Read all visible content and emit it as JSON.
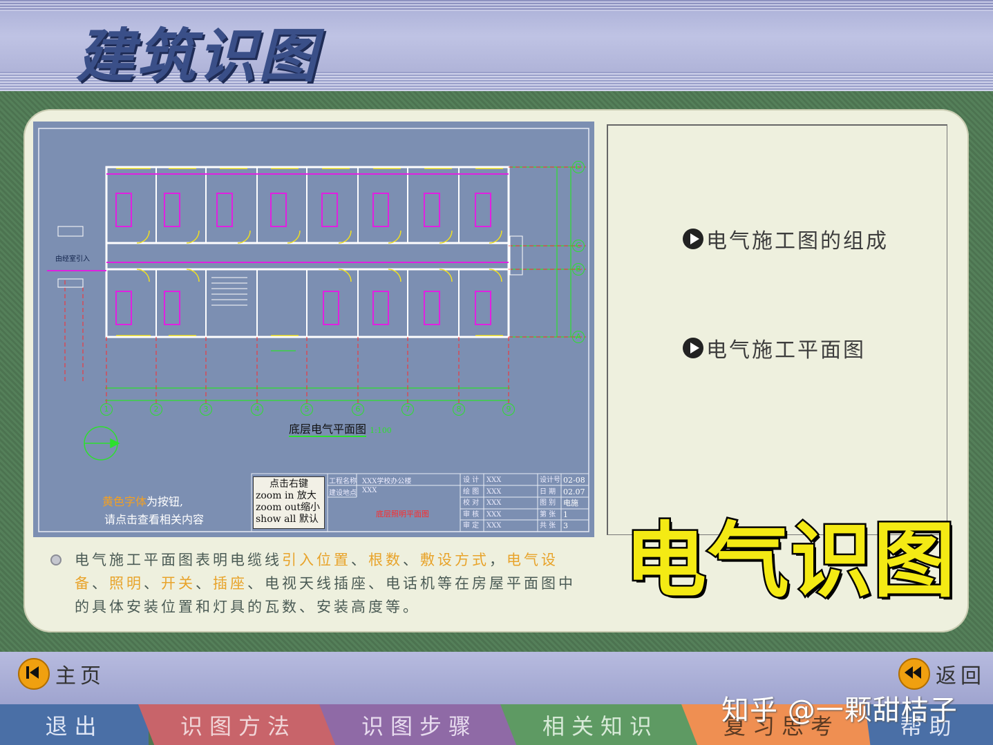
{
  "header": {
    "title": "建筑识图"
  },
  "drawing": {
    "plan_title": "底层电气平面图",
    "plan_scale": "1:100",
    "cable_entry_label": "由经室引入",
    "button_hint_highlight": "黄色字体",
    "button_hint_rest": "为按钮,",
    "button_hint_line2": "请点击查看相关内容",
    "zoom_box": {
      "title": "点击右键",
      "rows": [
        "zoom in  放大",
        "zoom out缩小",
        "show all  默认"
      ]
    },
    "title_block": {
      "project_label": "工程名称",
      "project_value": "XXX学校办公楼",
      "site_label": "建设地点",
      "site_value": "XXX",
      "drawing_name": "底层照明平面图",
      "designer_label": "设 计",
      "drafter_label": "绘 图",
      "checker_label": "校 对",
      "reviewer_label": "审 核",
      "approver_label": "审 定",
      "person_value": "XXX",
      "no_label": "设计号",
      "no_value": "02-08",
      "date_label": "日 期",
      "date_value": "02.07",
      "type_label": "图 别",
      "type_value": "电施",
      "sheet_label": "第 张",
      "sheet_value": "1",
      "total_label": "共 张",
      "total_value": "3"
    },
    "grid_bottom": [
      "1",
      "2",
      "3",
      "4",
      "5",
      "6",
      "7",
      "8",
      "9"
    ],
    "grid_right": [
      "D",
      "C",
      "B",
      "A"
    ]
  },
  "menu": [
    {
      "label": "电气施工图的组成"
    },
    {
      "label": "电气施工平面图"
    }
  ],
  "big_title": "电气识图",
  "description": {
    "part1": "电气施工平面图表明电缆线",
    "hl1": "引入位置",
    "sep1": "、",
    "hl2": "根数",
    "sep2": "、",
    "hl3": "敷设方式",
    "sep3": "，",
    "hl4": "电气设备",
    "sep4": "、",
    "hl5": "照明",
    "sep5": "、",
    "hl6": "开关",
    "sep6": "、",
    "hl7": "插座",
    "part2": "、电视天线插座、电话机等在房屋平面图中的具体安装位置和灯具的瓦数、安装高度等。"
  },
  "nav": {
    "home": "主页",
    "back": "返回",
    "watermark": "知乎 @一颗甜桔子"
  },
  "tabs": [
    {
      "label": "退出",
      "bg": "#4a6fa6",
      "color": "#dfe6f5"
    },
    {
      "label": "识图方法",
      "bg": "#c8646a",
      "color": "#f1d6d8"
    },
    {
      "label": "识图步骤",
      "bg": "#8f6aa6",
      "color": "#e8dcef"
    },
    {
      "label": "相关知识",
      "bg": "#5e9a63",
      "color": "#d8ead8"
    },
    {
      "label": "复习思考",
      "bg": "#ef8f52",
      "color": "#5b3a22"
    },
    {
      "label": "帮助",
      "bg": "#4a6fa6",
      "color": "#dfe6f5"
    }
  ]
}
